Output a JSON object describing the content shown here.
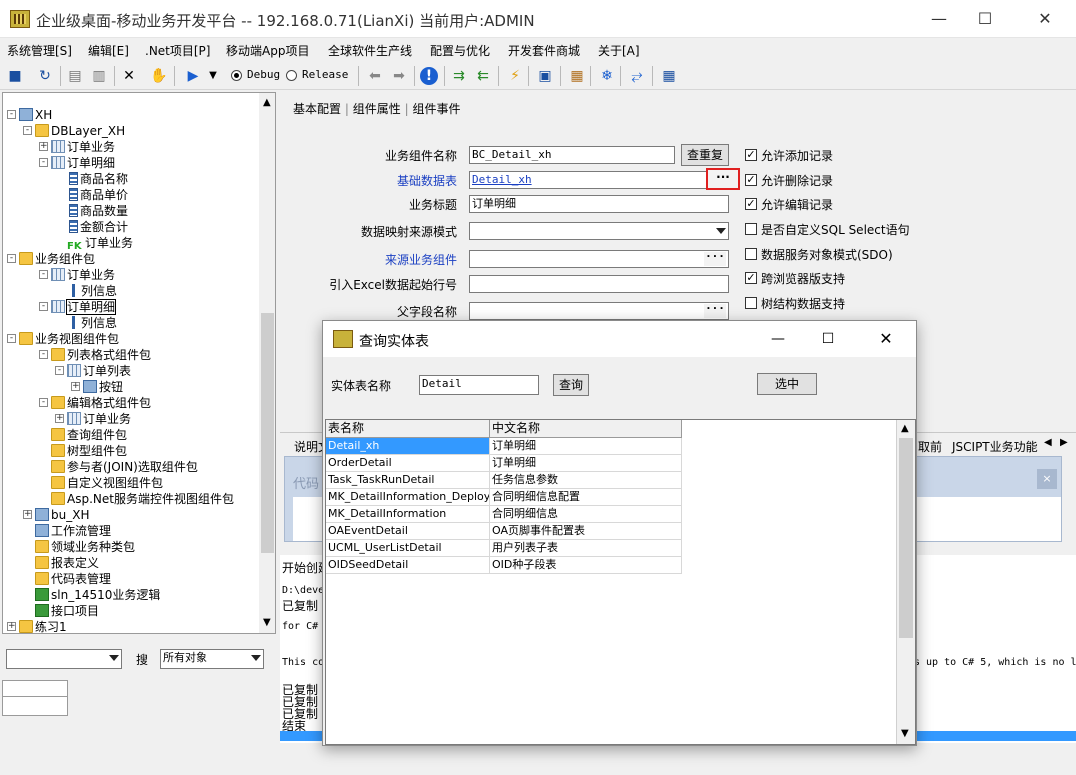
{
  "window": {
    "title": "企业级桌面-移动业务开发平台 -- 192.168.0.71(LianXi) 当前用户:ADMIN"
  },
  "menu": [
    "系统管理[S]",
    "编辑[E]",
    ".Net项目[P]",
    "移动端App项目",
    "全球软件生产线",
    "配置与优化",
    "开发套件商城",
    "关于[A]"
  ],
  "toolbar": {
    "debug_label": "Debug",
    "release_label": "Release",
    "selected_mode": "Debug"
  },
  "tree": [
    {
      "label": "XH",
      "icon": "db-icon"
    },
    {
      "label": "DBLayer_XH",
      "icon": "folder-icon"
    },
    {
      "label": "订单业务",
      "icon": "table-icon"
    },
    {
      "label": "订单明细",
      "icon": "table-icon"
    },
    {
      "label": "商品名称",
      "icon": "column-icon"
    },
    {
      "label": "商品单价",
      "icon": "column-icon"
    },
    {
      "label": "商品数量",
      "icon": "column-icon"
    },
    {
      "label": "金额合计",
      "icon": "column-icon"
    },
    {
      "label": "订单业务",
      "icon": "fk-icon",
      "badge": "FK"
    },
    {
      "label": "业务组件包",
      "icon": "folder-icon"
    },
    {
      "label": "订单业务",
      "icon": "grid-icon"
    },
    {
      "label": "列信息",
      "icon": "pin-icon"
    },
    {
      "label": "订单明细",
      "icon": "grid-icon"
    },
    {
      "label": "列信息",
      "icon": "pin-icon"
    },
    {
      "label": "业务视图组件包",
      "icon": "folder-icon"
    },
    {
      "label": "列表格式组件包",
      "icon": "folder-icon"
    },
    {
      "label": "订单列表",
      "icon": "grid-icon"
    },
    {
      "label": "按钮",
      "icon": "button-icon"
    },
    {
      "label": "编辑格式组件包",
      "icon": "folder-icon"
    },
    {
      "label": "订单业务",
      "icon": "grid-icon"
    },
    {
      "label": "查询组件包",
      "icon": "folder-icon"
    },
    {
      "label": "树型组件包",
      "icon": "folder-icon"
    },
    {
      "label": "参与者(JOIN)选取组件包",
      "icon": "folder-icon"
    },
    {
      "label": "自定义视图组件包",
      "icon": "folder-icon"
    },
    {
      "label": "Asp.Net服务端控件视图组件包",
      "icon": "folder-icon"
    },
    {
      "label": "bu_XH",
      "icon": "bu-icon"
    },
    {
      "label": "工作流管理",
      "icon": "workflow-icon"
    },
    {
      "label": "领域业务种类包",
      "icon": "domain-icon"
    },
    {
      "label": "报表定义",
      "icon": "folder-icon"
    },
    {
      "label": "代码表管理",
      "icon": "folder-icon"
    },
    {
      "label": "sln_14510业务逻辑",
      "icon": "csharp-icon"
    },
    {
      "label": "接口项目",
      "icon": "csharp-icon"
    },
    {
      "label": "练习1",
      "icon": "folder-icon"
    }
  ],
  "search": {
    "label": "搜",
    "scope_value": "所有对象"
  },
  "props": {
    "tabs": [
      "基本配置",
      "组件属性",
      "组件事件"
    ],
    "component_name_label": "业务组件名称",
    "component_name_value": "BC_Detail_xh",
    "reset_button": "查重复",
    "base_table_label": "基础数据表",
    "base_table_value": "Detail_xh",
    "title_label": "业务标题",
    "title_value": "订单明细",
    "mapping_label": "数据映射来源模式",
    "source_component_label": "来源业务组件",
    "excel_row_label": "引入Excel数据起始行号",
    "parent_field_label": "父字段名称",
    "checkboxes": [
      {
        "label": "允许添加记录",
        "checked": true
      },
      {
        "label": "允许删除记录",
        "checked": true
      },
      {
        "label": "允许编辑记录",
        "checked": true
      },
      {
        "label": "是否自定义SQL Select语句",
        "checked": false
      },
      {
        "label": "数据服务对象模式(SDO)",
        "checked": false
      },
      {
        "label": "跨浏览器版支持",
        "checked": true
      },
      {
        "label": "树结构数据支持",
        "checked": false
      }
    ]
  },
  "bottom_tabs": {
    "left": "说明文",
    "right1": "取前",
    "right2": "JSCIPT业务功能"
  },
  "code_panel_label": "代码",
  "log": {
    "header": "开始创建",
    "lines": [
      "D:\\deve",
      "已复制",
      "for C#",
      "This co",
      "已复制",
      "已复制",
      "已复制",
      "结束"
    ],
    "right_text": "s up to C# 5, which is no l"
  },
  "dialog": {
    "title": "查询实体表",
    "field_label": "实体表名称",
    "field_value": "Detail",
    "query_button": "查询",
    "select_button": "选中",
    "columns": [
      "表名称",
      "中文名称"
    ],
    "rows": [
      [
        "Detail_xh",
        "订单明细"
      ],
      [
        "OrderDetail",
        "订单明细"
      ],
      [
        "Task_TaskRunDetail",
        "任务信息参数"
      ],
      [
        "MK_DetailInformation_Deploy",
        "合同明细信息配置"
      ],
      [
        "MK_DetailInformation",
        "合同明细信息"
      ],
      [
        "OAEventDetail",
        "OA页脚事件配置表"
      ],
      [
        "UCML_UserListDetail",
        "用户列表子表"
      ],
      [
        "OIDSeedDetail",
        "OID种子段表"
      ]
    ],
    "selected_row": 0
  },
  "colors": {
    "selection": "#3399ff",
    "highlight_box": "#e02020",
    "link_blue": "#1a3fc2"
  }
}
